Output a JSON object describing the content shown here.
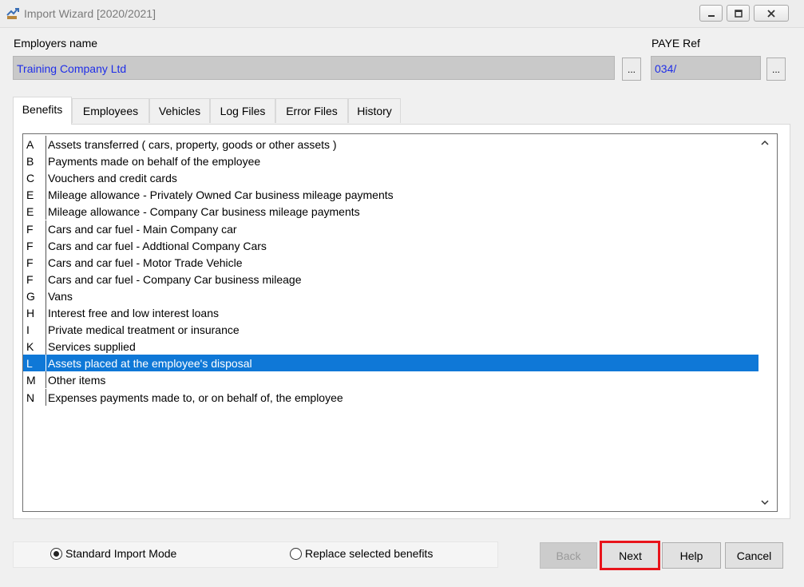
{
  "window": {
    "title": "Import Wizard [2020/2021]"
  },
  "header": {
    "employers_label": "Employers name",
    "employers_value": "Training Company Ltd",
    "paye_label": "PAYE Ref",
    "paye_value": "034/",
    "browse_label": "..."
  },
  "tabs": [
    {
      "label": "Benefits",
      "active": true
    },
    {
      "label": "Employees"
    },
    {
      "label": "Vehicles"
    },
    {
      "label": "Log Files"
    },
    {
      "label": "Error Files"
    },
    {
      "label": "History"
    }
  ],
  "benefits": [
    {
      "code": "A",
      "desc": "Assets transferred ( cars, property, goods or other assets )"
    },
    {
      "code": "B",
      "desc": "Payments made on behalf of the employee"
    },
    {
      "code": "C",
      "desc": "Vouchers and credit cards"
    },
    {
      "code": "E",
      "desc": "Mileage allowance - Privately Owned Car business mileage payments"
    },
    {
      "code": "E",
      "desc": "Mileage allowance - Company Car business mileage payments"
    },
    {
      "code": "F",
      "desc": "Cars and car fuel - Main Company car"
    },
    {
      "code": "F",
      "desc": "Cars and car fuel - Addtional Company Cars"
    },
    {
      "code": "F",
      "desc": "Cars and car fuel - Motor Trade Vehicle"
    },
    {
      "code": "F",
      "desc": "Cars and car fuel - Company Car business mileage"
    },
    {
      "code": "G",
      "desc": "Vans"
    },
    {
      "code": "H",
      "desc": "Interest free and low interest loans"
    },
    {
      "code": "I",
      "desc": "Private medical treatment or insurance"
    },
    {
      "code": "K",
      "desc": "Services supplied"
    },
    {
      "code": "L",
      "desc": "Assets placed at the employee's disposal",
      "selected": true
    },
    {
      "code": "M",
      "desc": "Other items"
    },
    {
      "code": "N",
      "desc": "Expenses payments made to, or on behalf of, the employee"
    }
  ],
  "modes": {
    "standard": "Standard Import Mode",
    "replace": "Replace selected benefits",
    "selected": "standard"
  },
  "buttons": {
    "back": "Back",
    "next": "Next",
    "help": "Help",
    "cancel": "Cancel"
  },
  "colors": {
    "selection": "#0f78d7",
    "field_text": "#1f2ee8",
    "highlight": "#e8141b"
  }
}
